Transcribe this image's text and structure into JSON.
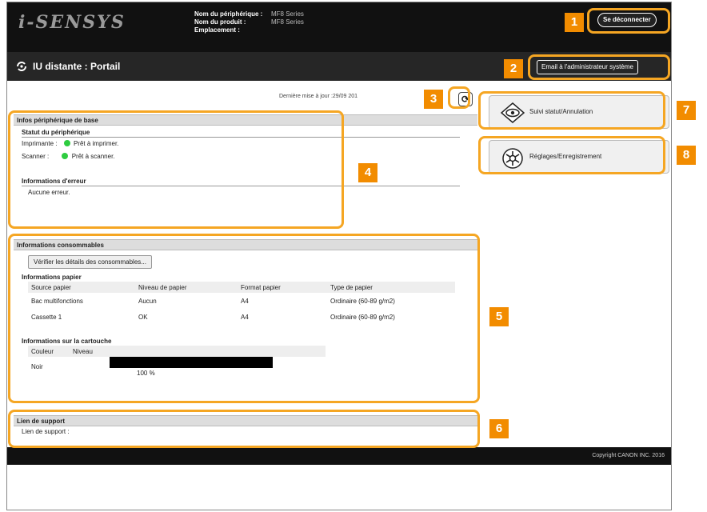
{
  "header": {
    "logo": "i-SENSYS",
    "device_name_label": "Nom du périphérique :",
    "product_name_label": "Nom du produit :",
    "location_label": "Emplacement :",
    "device_name_value": "MF8 Series",
    "product_name_value": "MF8 Series",
    "logout_label": "Se déconnecter"
  },
  "titlebar": {
    "title": "IU distante : Portail",
    "admin_email_label": "Email à l'administrateur système"
  },
  "updated": "Dernière mise à jour :29/09 201",
  "refresh_icon": "refresh-icon",
  "basic_info": {
    "heading": "Infos périphérique de base",
    "device_status_title": "Statut du périphérique",
    "printer_label": "Imprimante :",
    "printer_status": "Prêt à imprimer.",
    "scanner_label": "Scanner :",
    "scanner_status": "Prêt à scanner.",
    "error_title": "Informations d'erreur",
    "error_text": "Aucune erreur."
  },
  "consumables": {
    "heading": "Informations consommables",
    "verify_button": "Vérifier les détails des consommables...",
    "paper_title": "Informations papier",
    "paper_columns": [
      "Source papier",
      "Niveau de papier",
      "Format papier",
      "Type de papier"
    ],
    "paper_rows": [
      [
        "Bac multifonctions",
        "Aucun",
        "A4",
        "Ordinaire (60-89 g/m2)"
      ],
      [
        "Cassette 1",
        "OK",
        "A4",
        "Ordinaire (60-89 g/m2)"
      ]
    ],
    "cartridge_title": "Informations sur la cartouche",
    "cartridge_columns": [
      "Couleur",
      "Niveau"
    ],
    "cartridge_color": "Noir",
    "cartridge_level_text": "100 %",
    "cartridge_level": 1.0
  },
  "support": {
    "heading": "Lien de support",
    "label": "Lien de support :"
  },
  "side_menu": {
    "status_label": "Suivi statut/Annulation",
    "settings_label": "Réglages/Enregistrement"
  },
  "footer": "Copyright CANON INC. 2016",
  "callouts": [
    "1",
    "2",
    "3",
    "4",
    "5",
    "6",
    "7",
    "8"
  ],
  "accent_color": "#f28c00"
}
